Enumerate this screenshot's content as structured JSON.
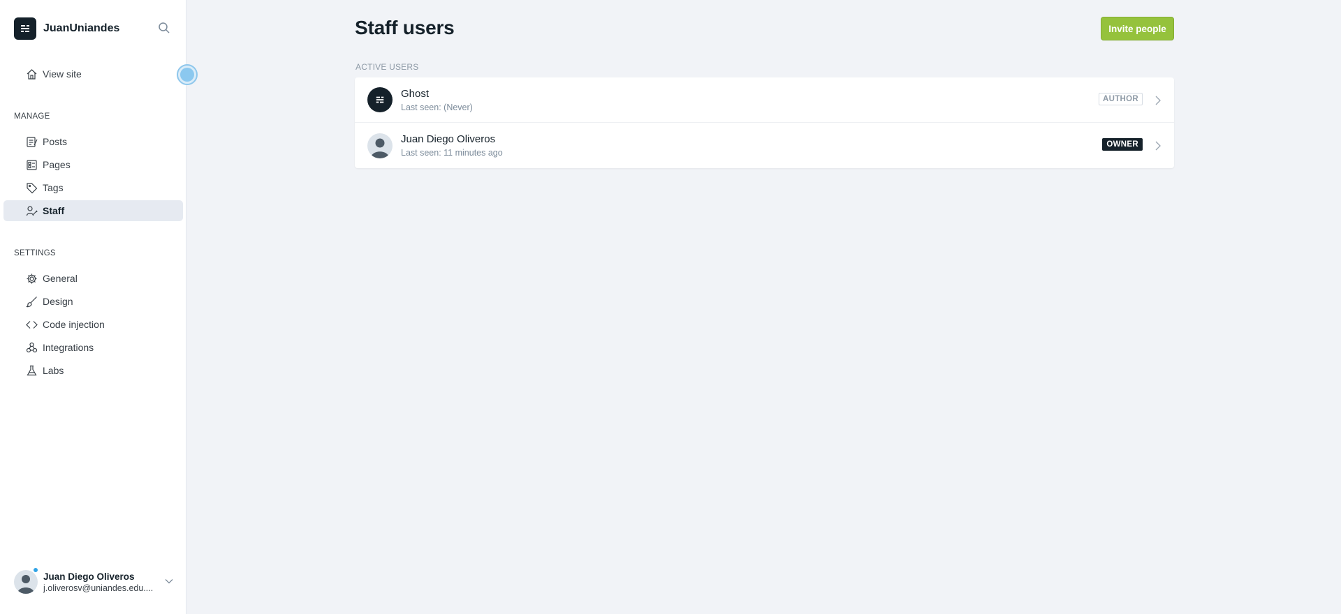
{
  "sidebar": {
    "brand": {
      "name": "JuanUniandes",
      "icon": "ghost-logo-icon"
    },
    "search_icon": "search-icon",
    "view_site": {
      "label": "View site",
      "icon": "home-icon"
    },
    "manage_title": "MANAGE",
    "manage_items": [
      {
        "label": "Posts",
        "icon": "posts-icon",
        "active": false
      },
      {
        "label": "Pages",
        "icon": "pages-icon",
        "active": false
      },
      {
        "label": "Tags",
        "icon": "tag-icon",
        "active": false
      },
      {
        "label": "Staff",
        "icon": "staff-icon",
        "active": true
      }
    ],
    "settings_title": "SETTINGS",
    "settings_items": [
      {
        "label": "General",
        "icon": "gear-icon"
      },
      {
        "label": "Design",
        "icon": "brush-icon"
      },
      {
        "label": "Code injection",
        "icon": "code-icon"
      },
      {
        "label": "Integrations",
        "icon": "integrations-icon"
      },
      {
        "label": "Labs",
        "icon": "flask-icon"
      }
    ],
    "user": {
      "name": "Juan Diego Oliveros",
      "email": "j.oliverosv@uniandes.edu...."
    }
  },
  "main": {
    "title": "Staff users",
    "invite_button": "Invite people",
    "active_users_label": "ACTIVE USERS",
    "users": [
      {
        "name": "Ghost",
        "last_seen": "Last seen: (Never)",
        "role": "AUTHOR"
      },
      {
        "name": "Juan Diego Oliveros",
        "last_seen": "Last seen: 11 minutes ago",
        "role": "OWNER"
      }
    ]
  },
  "colors": {
    "accent_green": "#95c23c",
    "dark": "#15212a",
    "background": "#f1f3f7",
    "notification_blue": "#30a3e6"
  }
}
